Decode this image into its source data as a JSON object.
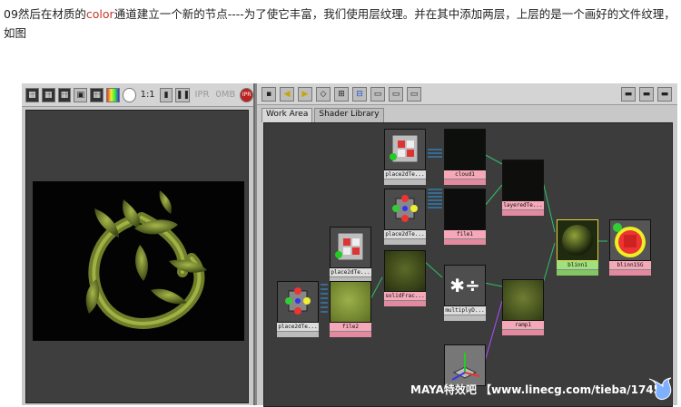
{
  "caption": {
    "prefix": "09然后在材质的",
    "highlight": "color",
    "body": "通道建立一个新的节点----为了使它丰富，我们使用层纹理。并在其中添加两层，上层的是一个画好的文件纹理，如图"
  },
  "render_view": {
    "toolbar": {
      "ratio_label": "1:1",
      "ipr_label": "IPR",
      "size_label": "0MB",
      "ipr_button": "IPR"
    }
  },
  "hypershade": {
    "tabs": [
      "Work Area",
      "Shader Library"
    ],
    "nodes": {
      "place2d_a": "place2dTe...",
      "cloud": "cloud1",
      "layered": "layeredTe...",
      "place2d_b": "place2dTe...",
      "file1": "file1",
      "place2d_c": "place2dTe...",
      "solid": "solidFrac...",
      "multiply": "multiplyD...",
      "blinn": "blinn1",
      "blinnsg": "blinn1SG",
      "place2d_d": "place2dTe...",
      "file2": "file2",
      "ramp": "ramp1",
      "place3d": ""
    }
  },
  "watermark": "MAYA特效吧 【www.linecg.com/tieba/1745】",
  "colors": {
    "caption_highlight": "#c0392b",
    "node_selected": "#f4a8b8",
    "node_green": "#9fe07f",
    "graph_bg": "#3c3c3c"
  }
}
